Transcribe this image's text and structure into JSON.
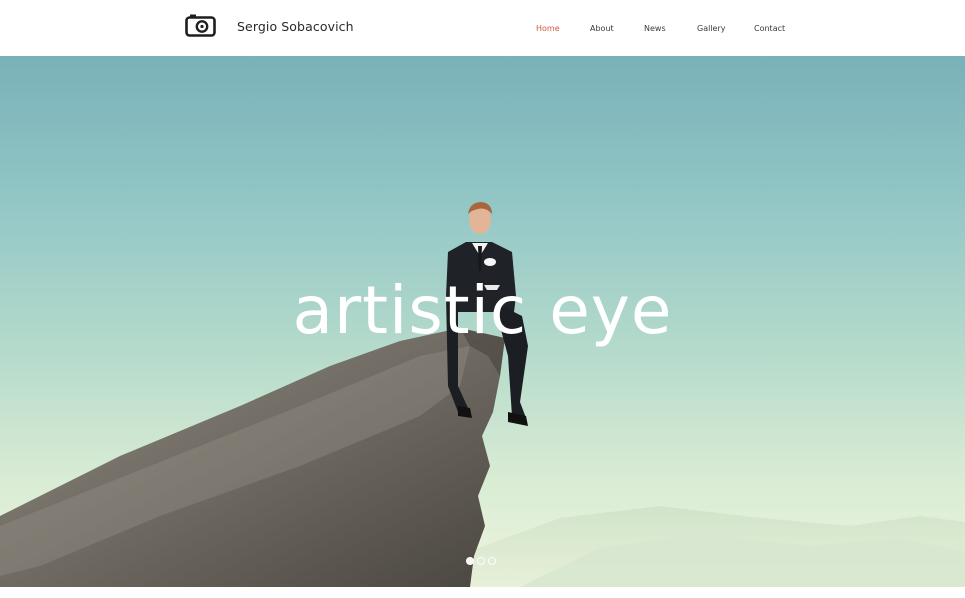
{
  "header": {
    "site_name": "Sergio Sobacovich",
    "logo_icon": "camera-icon"
  },
  "nav": {
    "items": [
      {
        "label": "Home",
        "active": true
      },
      {
        "label": "About",
        "active": false
      },
      {
        "label": "News",
        "active": false
      },
      {
        "label": "Gallery",
        "active": false
      },
      {
        "label": "Contact",
        "active": false
      }
    ],
    "active_color": "#d4573b"
  },
  "hero": {
    "headline": "artistic eye",
    "slides": [
      {
        "active": true
      },
      {
        "active": false
      },
      {
        "active": false
      }
    ]
  }
}
